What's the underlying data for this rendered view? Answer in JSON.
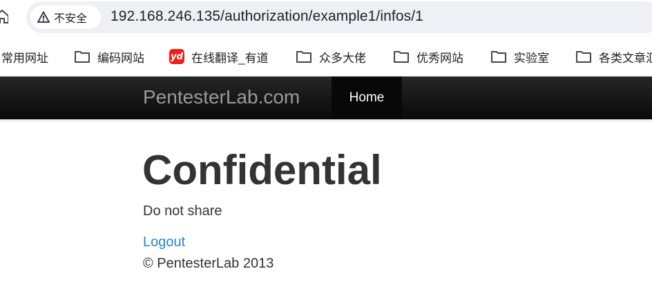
{
  "browser": {
    "security_label": "不安全",
    "url": "192.168.246.135/authorization/example1/infos/1"
  },
  "bookmarks": [
    {
      "label": "常用网址",
      "icon": "folder-icon"
    },
    {
      "label": "编码网站",
      "icon": "folder-icon"
    },
    {
      "label": "在线翻译_有道",
      "icon": "youdao-icon",
      "icon_text": "yd"
    },
    {
      "label": "众多大佬",
      "icon": "folder-icon"
    },
    {
      "label": "优秀网站",
      "icon": "folder-icon"
    },
    {
      "label": "实验室",
      "icon": "folder-icon"
    },
    {
      "label": "各类文章汇",
      "icon": "folder-icon"
    }
  ],
  "navbar": {
    "brand": "PentesterLab.com",
    "home_label": "Home"
  },
  "main": {
    "title": "Confidential",
    "text": "Do not share",
    "logout_label": "Logout"
  },
  "footer": {
    "text": "© PentesterLab 2013"
  },
  "colors": {
    "navbar_bg": "#111111",
    "link": "#2a86c4",
    "youdao_red": "#e8221f"
  }
}
